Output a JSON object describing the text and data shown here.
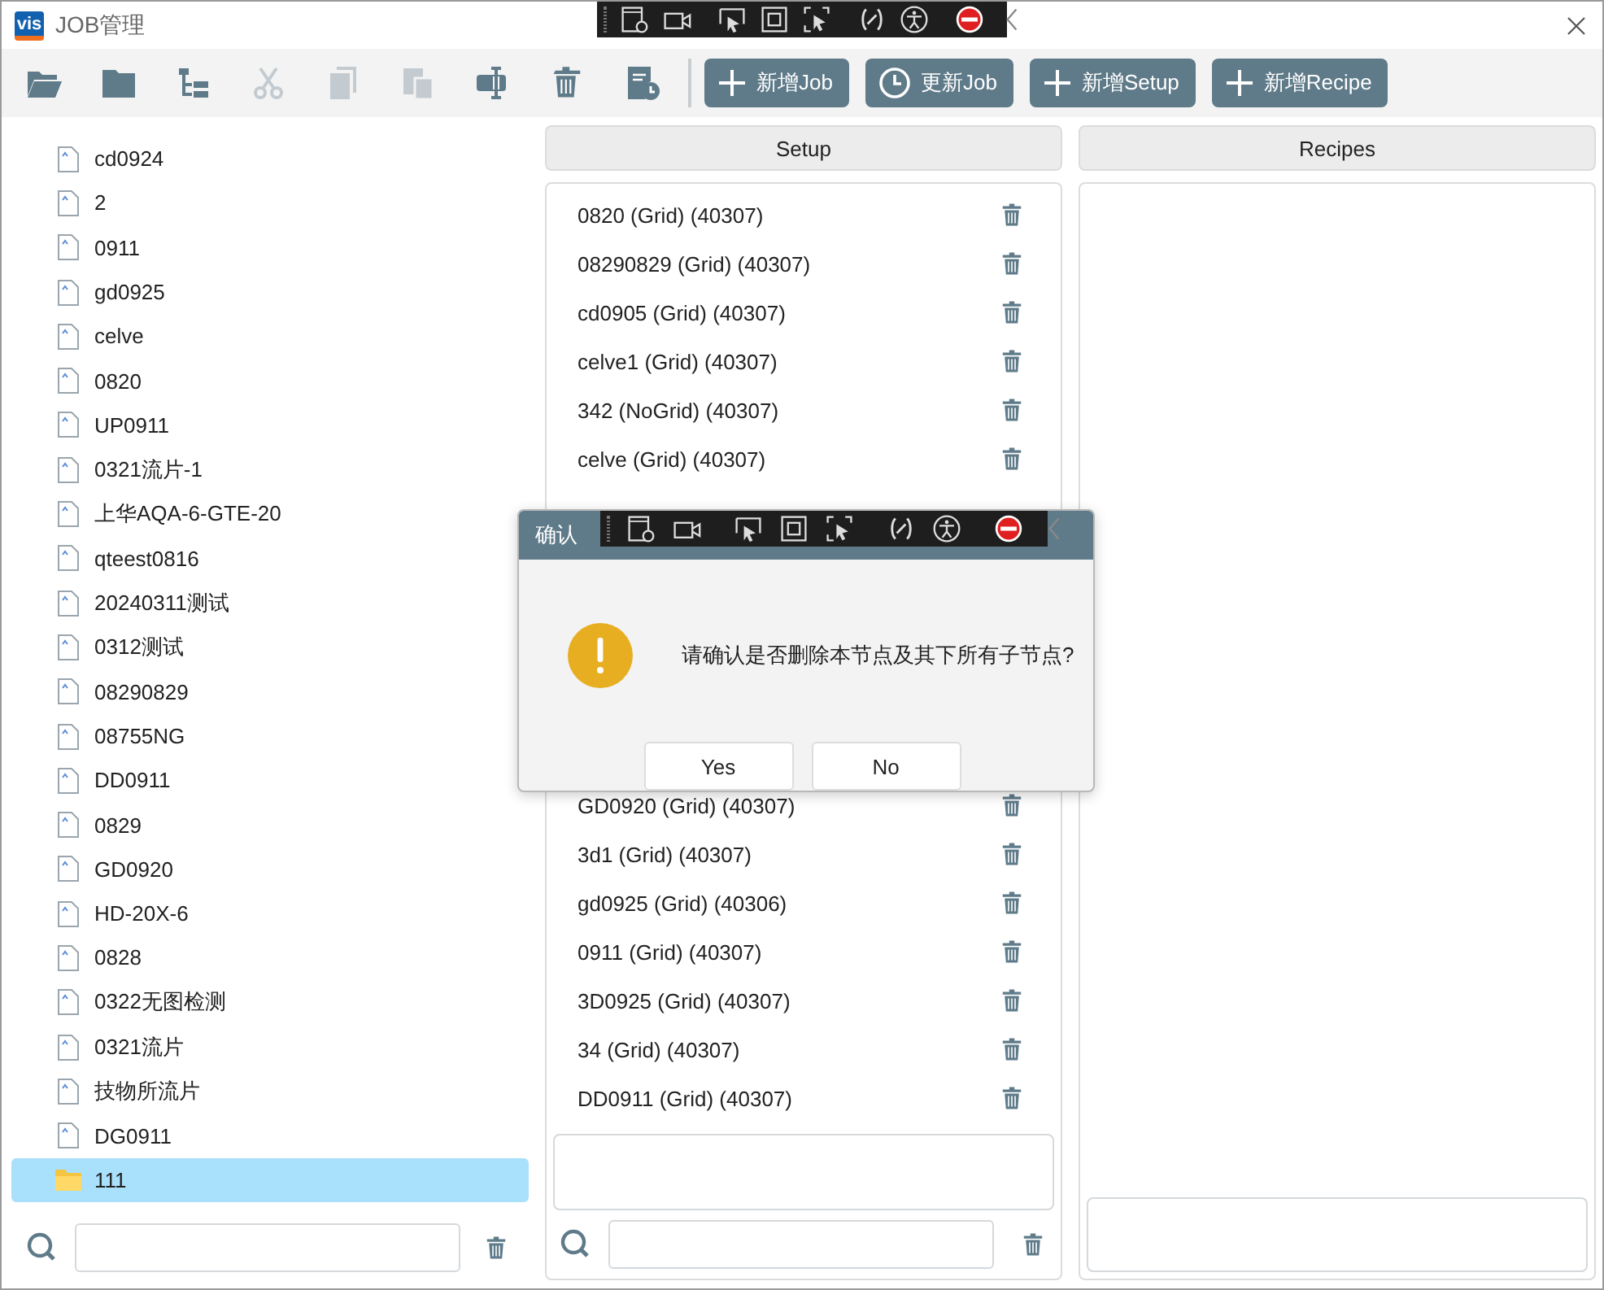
{
  "window": {
    "logo": "vis",
    "title": "JOB管理"
  },
  "toolbar": {
    "tools": [
      {
        "kind": "open-folder",
        "disabled": false
      },
      {
        "kind": "folder",
        "disabled": false
      },
      {
        "kind": "tree",
        "disabled": false
      },
      {
        "kind": "cut",
        "disabled": true
      },
      {
        "kind": "copy",
        "disabled": true
      },
      {
        "kind": "paste",
        "disabled": true
      },
      {
        "kind": "rename",
        "disabled": false
      },
      {
        "kind": "delete",
        "disabled": false
      },
      {
        "kind": "schedule",
        "disabled": false
      }
    ],
    "buttons": [
      {
        "kind": "add",
        "label": "新增Job"
      },
      {
        "kind": "update",
        "label": "更新Job"
      },
      {
        "kind": "add",
        "label": "新增Setup"
      },
      {
        "kind": "add",
        "label": "新增Recipe"
      }
    ]
  },
  "job_tree": {
    "items": [
      {
        "kind": "file",
        "label": "cd0924",
        "selected": false
      },
      {
        "kind": "file",
        "label": "2",
        "selected": false
      },
      {
        "kind": "file",
        "label": "0911",
        "selected": false
      },
      {
        "kind": "file",
        "label": "gd0925",
        "selected": false
      },
      {
        "kind": "file",
        "label": "celve",
        "selected": false
      },
      {
        "kind": "file",
        "label": "0820",
        "selected": false
      },
      {
        "kind": "file",
        "label": "UP0911",
        "selected": false
      },
      {
        "kind": "file",
        "label": "0321流片-1",
        "selected": false
      },
      {
        "kind": "file",
        "label": "上华AQA-6-GTE-20",
        "selected": false
      },
      {
        "kind": "file",
        "label": "qteest0816",
        "selected": false
      },
      {
        "kind": "file",
        "label": "20240311测试",
        "selected": false
      },
      {
        "kind": "file",
        "label": "0312测试",
        "selected": false
      },
      {
        "kind": "file",
        "label": "08290829",
        "selected": false
      },
      {
        "kind": "file",
        "label": "08755NG",
        "selected": false
      },
      {
        "kind": "file",
        "label": "DD0911",
        "selected": false
      },
      {
        "kind": "file",
        "label": "0829",
        "selected": false
      },
      {
        "kind": "file",
        "label": "GD0920",
        "selected": false
      },
      {
        "kind": "file",
        "label": "HD-20X-6",
        "selected": false
      },
      {
        "kind": "file",
        "label": "0828",
        "selected": false
      },
      {
        "kind": "file",
        "label": "0322无图检测",
        "selected": false
      },
      {
        "kind": "file",
        "label": "0321流片",
        "selected": false
      },
      {
        "kind": "file",
        "label": "技物所流片",
        "selected": false
      },
      {
        "kind": "file",
        "label": "DG0911",
        "selected": false
      },
      {
        "kind": "folder",
        "label": "111",
        "selected": true
      }
    ]
  },
  "setup": {
    "header": "Setup",
    "items_above": [
      "0820 (Grid) (40307)",
      "08290829 (Grid) (40307)",
      "cd0905 (Grid) (40307)",
      "celve1 (Grid) (40307)",
      "342 (NoGrid) (40307)",
      "celve (Grid) (40307)"
    ],
    "items_below": [
      "GD0920 (Grid) (40307)",
      "3d1 (Grid) (40307)",
      "gd0925 (Grid) (40306)",
      "0911 (Grid) (40307)",
      "3D0925 (Grid) (40307)",
      "34 (Grid) (40307)",
      "DD0911 (Grid) (40307)"
    ]
  },
  "recipes": {
    "header": "Recipes"
  },
  "dialog": {
    "title": "确认",
    "message": "请确认是否删除本节点及其下所有子节点?",
    "buttons": [
      "Yes",
      "No"
    ]
  }
}
